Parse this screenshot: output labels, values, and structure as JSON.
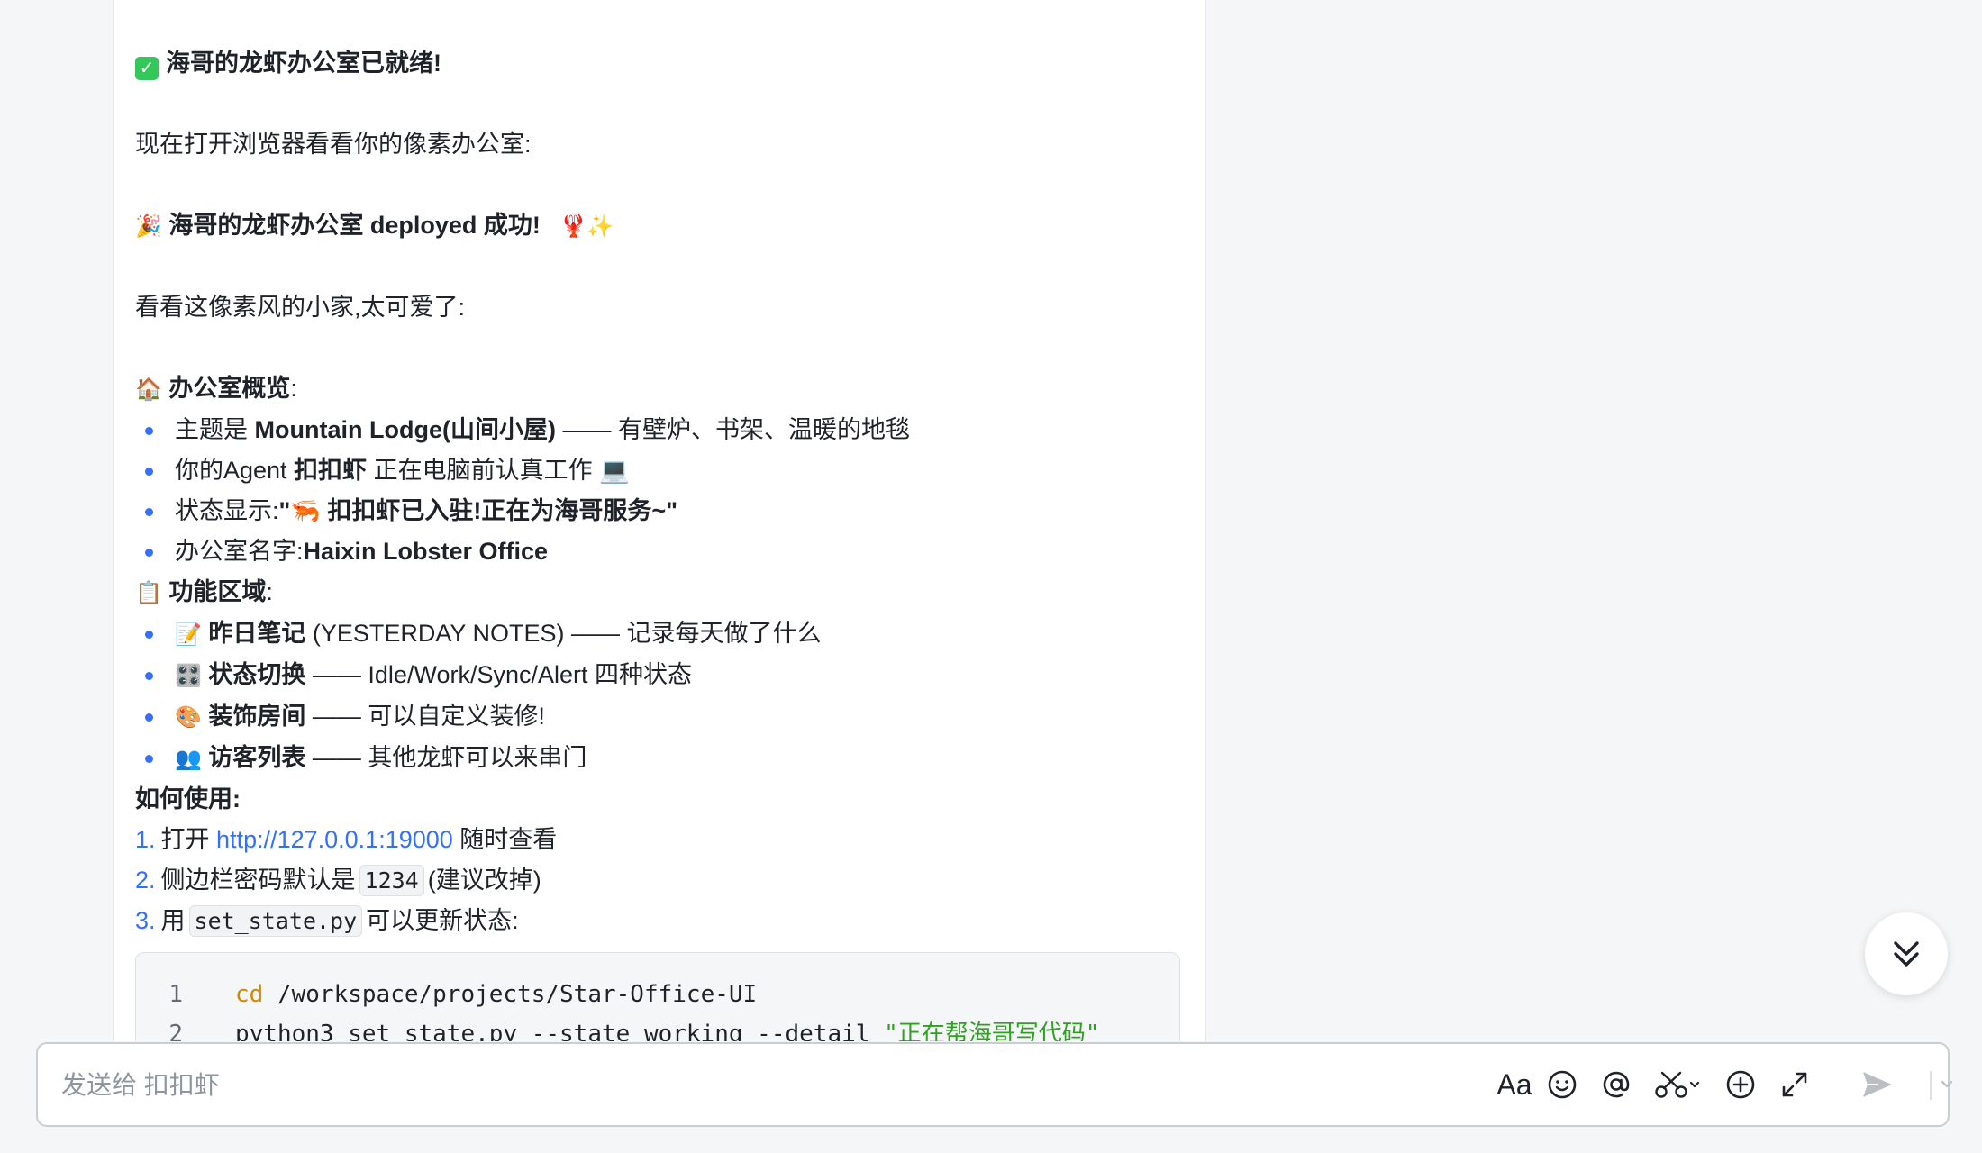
{
  "message": {
    "ready_emoji": "✓",
    "ready_title": "海哥的龙虾办公室已就绪!",
    "open_browser": "现在打开浏览器看看你的像素办公室:",
    "deployed_emoji": "🎉",
    "deployed_title": "海哥的龙虾办公室 deployed 成功!",
    "deployed_emoji_tail": "🦞✨",
    "look": "看看这像素风的小家,太可爱了:",
    "overview_emoji": "🏠",
    "overview_title": "办公室概览",
    "overview_colon": ":",
    "overview_items": [
      {
        "a": "主题是 ",
        "b": "Mountain Lodge(山间小屋)",
        "c": " —— 有壁炉、书架、温暖的地毯"
      },
      {
        "a": "你的Agent ",
        "b": "扣扣虾",
        "c": " 正在电脑前认真工作 💻"
      },
      {
        "a": "状态显示:",
        "b": "\"🦐 扣扣虾已入驻!正在为海哥服务~\"",
        "c": ""
      },
      {
        "a": "办公室名字:",
        "b": "Haixin Lobster Office",
        "c": ""
      }
    ],
    "features_emoji": "📋",
    "features_title": "功能区域",
    "features_colon": ":",
    "features_items": [
      {
        "emoji": "📝",
        "b": "昨日笔记",
        "c": " (YESTERDAY NOTES) —— 记录每天做了什么"
      },
      {
        "emoji": "🎛️",
        "b": "状态切换",
        "c": " —— Idle/Work/Sync/Alert 四种状态"
      },
      {
        "emoji": "🎨",
        "b": "装饰房间",
        "c": " —— 可以自定义装修!"
      },
      {
        "emoji": "👥",
        "b": "访客列表",
        "c": " —— 其他龙虾可以来串门"
      }
    ],
    "howto_title": "如何使用",
    "howto_colon": ":",
    "steps": {
      "s1_num": "1.",
      "s1_a": "打开 ",
      "s1_link": "http://127.0.0.1:19000",
      "s1_b": " 随时查看",
      "s2_num": "2.",
      "s2_a": "侧边栏密码默认是",
      "s2_code": "1234",
      "s2_b": "(建议改掉)",
      "s3_num": "3.",
      "s3_a": "用",
      "s3_code": "set_state.py",
      "s3_b": "可以更新状态:"
    },
    "code": {
      "l1_num": "1",
      "l1_kw": "cd",
      "l1_rest": " /workspace/projects/Star-Office-UI",
      "l2_num": "2",
      "l2_rest": "python3 set_state.py --state working --detail ",
      "l2_str": "\"正在帮海哥写代码\""
    }
  },
  "composer": {
    "placeholder": "发送给 扣扣虾",
    "format_label": "Aa"
  },
  "colors": {
    "accent": "#3370ff",
    "keyword": "#d48806",
    "string": "#2ea121"
  },
  "icons": [
    "format-icon",
    "emoji-icon",
    "mention-icon",
    "scissors-icon",
    "add-icon",
    "expand-icon",
    "send-icon",
    "chevron-down-icon",
    "double-chevron-down-icon"
  ]
}
